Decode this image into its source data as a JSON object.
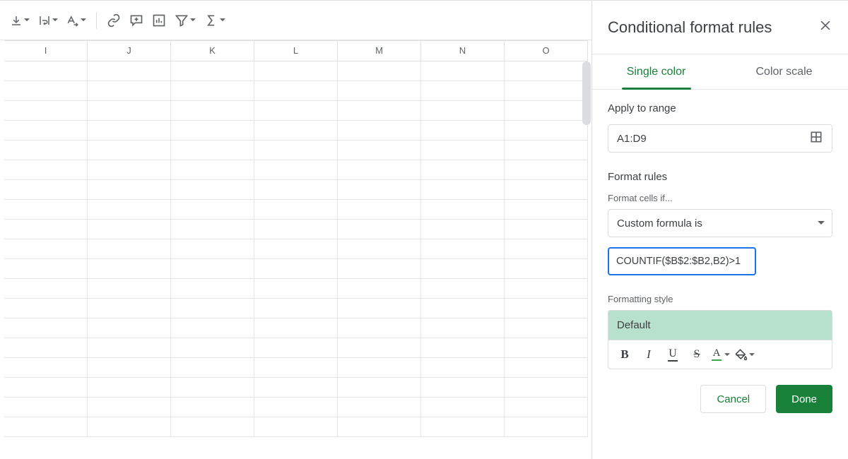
{
  "toolbar": {
    "icons": [
      "vertical-align-bottom",
      "text-wrap",
      "text-rotation",
      "insert-link",
      "insert-comment",
      "insert-chart",
      "filter",
      "functions"
    ]
  },
  "sheet": {
    "columns": [
      "I",
      "J",
      "K",
      "L",
      "M",
      "N",
      "O"
    ],
    "rowCount": 19
  },
  "panel": {
    "title": "Conditional format rules",
    "tabs": {
      "single": "Single color",
      "scale": "Color scale"
    },
    "apply_label": "Apply to range",
    "range_value": "A1:D9",
    "format_rules_label": "Format rules",
    "cells_if_label": "Format cells if...",
    "condition_select": "Custom formula is",
    "formula_value": "COUNTIF($B$2:$B2,B2)>1",
    "style_label": "Formatting style",
    "style_preview": "Default",
    "fmt_buttons": {
      "bold": "B",
      "italic": "I",
      "underline": "U",
      "strike": "S",
      "textcolor": "A"
    },
    "cancel": "Cancel",
    "done": "Done"
  }
}
